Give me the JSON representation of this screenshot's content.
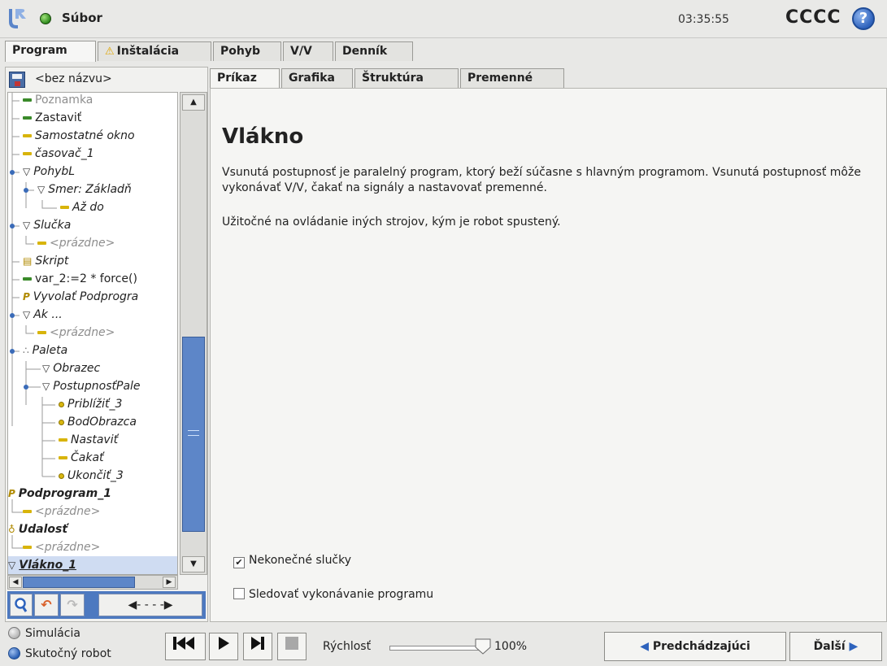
{
  "titlebar": {
    "file_menu": "Súbor",
    "clock": "03:35:55",
    "robot_name": "CCCC",
    "help": "?"
  },
  "main_tabs": [
    "Program",
    "Inštalácia",
    "Pohyb",
    "V/V",
    "Denník"
  ],
  "left": {
    "program_name": "<bez názvu>",
    "tree": [
      {
        "label": "Poznamka",
        "icon": "green-dash"
      },
      {
        "label": "Zastaviť",
        "icon": "green-dash"
      },
      {
        "label": "Samostatné okno",
        "icon": "yellow-dash"
      },
      {
        "label": "časovač_1",
        "icon": "yellow-dash"
      },
      {
        "label": "PohybL",
        "icon": "triangle"
      },
      {
        "label": "Smer: Základň",
        "icon": "triangle"
      },
      {
        "label": "Až do",
        "icon": "yellow-dash"
      },
      {
        "label": "Slučka",
        "icon": "triangle"
      },
      {
        "label": "<prázdne>",
        "icon": "yellow-dash"
      },
      {
        "label": "Skript",
        "icon": "script-icon"
      },
      {
        "label": "var_2:=2 * force()",
        "icon": "green-dash"
      },
      {
        "label": "Vyvolať Podprogra",
        "icon": "subprogram-icon"
      },
      {
        "label": "Ak ...",
        "icon": "triangle"
      },
      {
        "label": "<prázdne>",
        "icon": "yellow-dash"
      },
      {
        "label": "Paleta",
        "icon": "pallet-icon"
      },
      {
        "label": "Obrazec",
        "icon": "triangle"
      },
      {
        "label": "PostupnosťPale",
        "icon": "triangle"
      },
      {
        "label": "Priblížiť_3",
        "icon": "waypoint"
      },
      {
        "label": "BodObrazca",
        "icon": "waypoint"
      },
      {
        "label": "Nastaviť",
        "icon": "yellow-dash"
      },
      {
        "label": "Čakať",
        "icon": "yellow-dash"
      },
      {
        "label": "Ukončiť_3",
        "icon": "waypoint"
      },
      {
        "label": "Podprogram_1",
        "icon": "subprogram-icon"
      },
      {
        "label": "<prázdne>",
        "icon": "yellow-dash"
      },
      {
        "label": "Udalosť",
        "icon": "event-icon"
      },
      {
        "label": "<prázdne>",
        "icon": "yellow-dash"
      },
      {
        "label": "Vlákno_1",
        "icon": "triangle"
      }
    ]
  },
  "sub_tabs": [
    "Príkaz",
    "Grafika",
    "Štruktúra",
    "Premenné"
  ],
  "content": {
    "title": "Vlákno",
    "desc1": "Vsunutá postupnosť je paralelný program, ktorý beží súčasne s hlavným programom. Vsunutá postupnosť môže vykonávať V/V, čakať na signály a nastavovať premenné.",
    "desc2": "Užitočné na ovládanie iných strojov, kým je robot spustený.",
    "checkbox_loop": "Nekonečné slučky",
    "checkbox_loop_checked": true,
    "checkbox_track": "Sledovať vykonávanie programu",
    "checkbox_track_checked": false
  },
  "bottom": {
    "mode_sim": "Simulácia",
    "mode_real": "Skutočný robot",
    "speed_label": "Rýchlosť",
    "speed_value": "100%",
    "speed_fraction": 1.0,
    "prev": "Predchádzajúci",
    "next": "Ďalší"
  }
}
